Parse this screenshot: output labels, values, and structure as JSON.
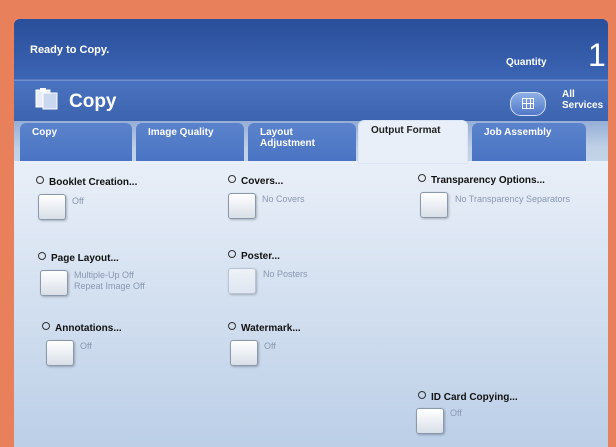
{
  "status": "Ready to Copy.",
  "quantity": {
    "label": "Quantity",
    "value": "1"
  },
  "header": {
    "title": "Copy",
    "all_services_line1": "All",
    "all_services_line2": "Services"
  },
  "tabs": [
    {
      "line1": "Copy",
      "line2": ""
    },
    {
      "line1": "Image Quality",
      "line2": ""
    },
    {
      "line1": "Layout",
      "line2": "Adjustment"
    },
    {
      "line1": "Output Format",
      "line2": ""
    },
    {
      "line1": "Job Assembly",
      "line2": ""
    }
  ],
  "options": {
    "booklet": {
      "label": "Booklet Creation...",
      "value": "Off"
    },
    "covers": {
      "label": "Covers...",
      "value": "No Covers"
    },
    "transparency": {
      "label": "Transparency Options...",
      "value": "No Transparency Separators"
    },
    "page_layout": {
      "label": "Page Layout...",
      "value1": "Multiple-Up Off",
      "value2": "Repeat Image Off"
    },
    "poster": {
      "label": "Poster...",
      "value": "No Posters"
    },
    "annotations": {
      "label": "Annotations...",
      "value": "Off"
    },
    "watermark": {
      "label": "Watermark...",
      "value": "Off"
    },
    "id_card": {
      "label": "ID Card Copying...",
      "value": "Off"
    }
  }
}
